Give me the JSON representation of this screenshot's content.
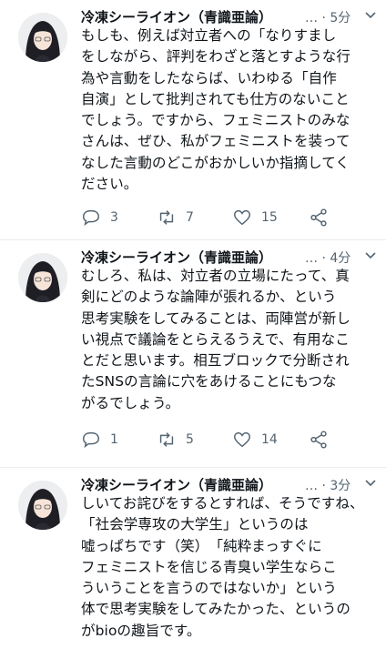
{
  "tweets": [
    {
      "author": "冷凍シーライオン（青識亜論）",
      "ellipsis": "…",
      "time": "· 5分",
      "text": "もしも、例えば対立者への「なりすまし\nをしながら、評判をわざと落とすような行\n為や言動をしたならば、いわゆる「自作\n自演」として批判されても仕方のないこと\nでしょう。ですから、フェミニストのみな\nさんは、ぜひ、私がフェミニストを装って\nなした言動のどこがおかしいか指摘してく\nださい。",
      "replies": "3",
      "retweets": "7",
      "likes": "15"
    },
    {
      "author": "冷凍シーライオン（青識亜論）",
      "ellipsis": "…",
      "time": "· 4分",
      "text": "むしろ、私は、対立者の立場にたって、真\n剣にどのような論陣が張れるか、という\n思考実験をしてみることは、両陣営が新し\nい視点で議論をとらえるうえで、有用なこ\nとだと思います。相互ブロックで分断され\nたSNSの言論に穴をあけることにもつな\nがるでしょう。",
      "replies": "1",
      "retweets": "5",
      "likes": "14"
    },
    {
      "author": "冷凍シーライオン（青識亜論）",
      "ellipsis": "…",
      "time": "· 3分",
      "text": "しいてお詫びをするとすれば、そうですね、「社会学専攻の大学生」というのは\n嘘っぱちです（笑）　「純粋まっすぐに\nフェミニストを信じる青臭い学生ならこ\nういうことを言うのではないか」という\n体で思考実験をしてみたかった、というの\nがbioの趣旨です。"
    }
  ],
  "icons": {
    "reply": "reply-icon",
    "retweet": "retweet-icon",
    "like": "heart-icon",
    "share": "share-icon",
    "caret": "chevron-down-icon"
  }
}
